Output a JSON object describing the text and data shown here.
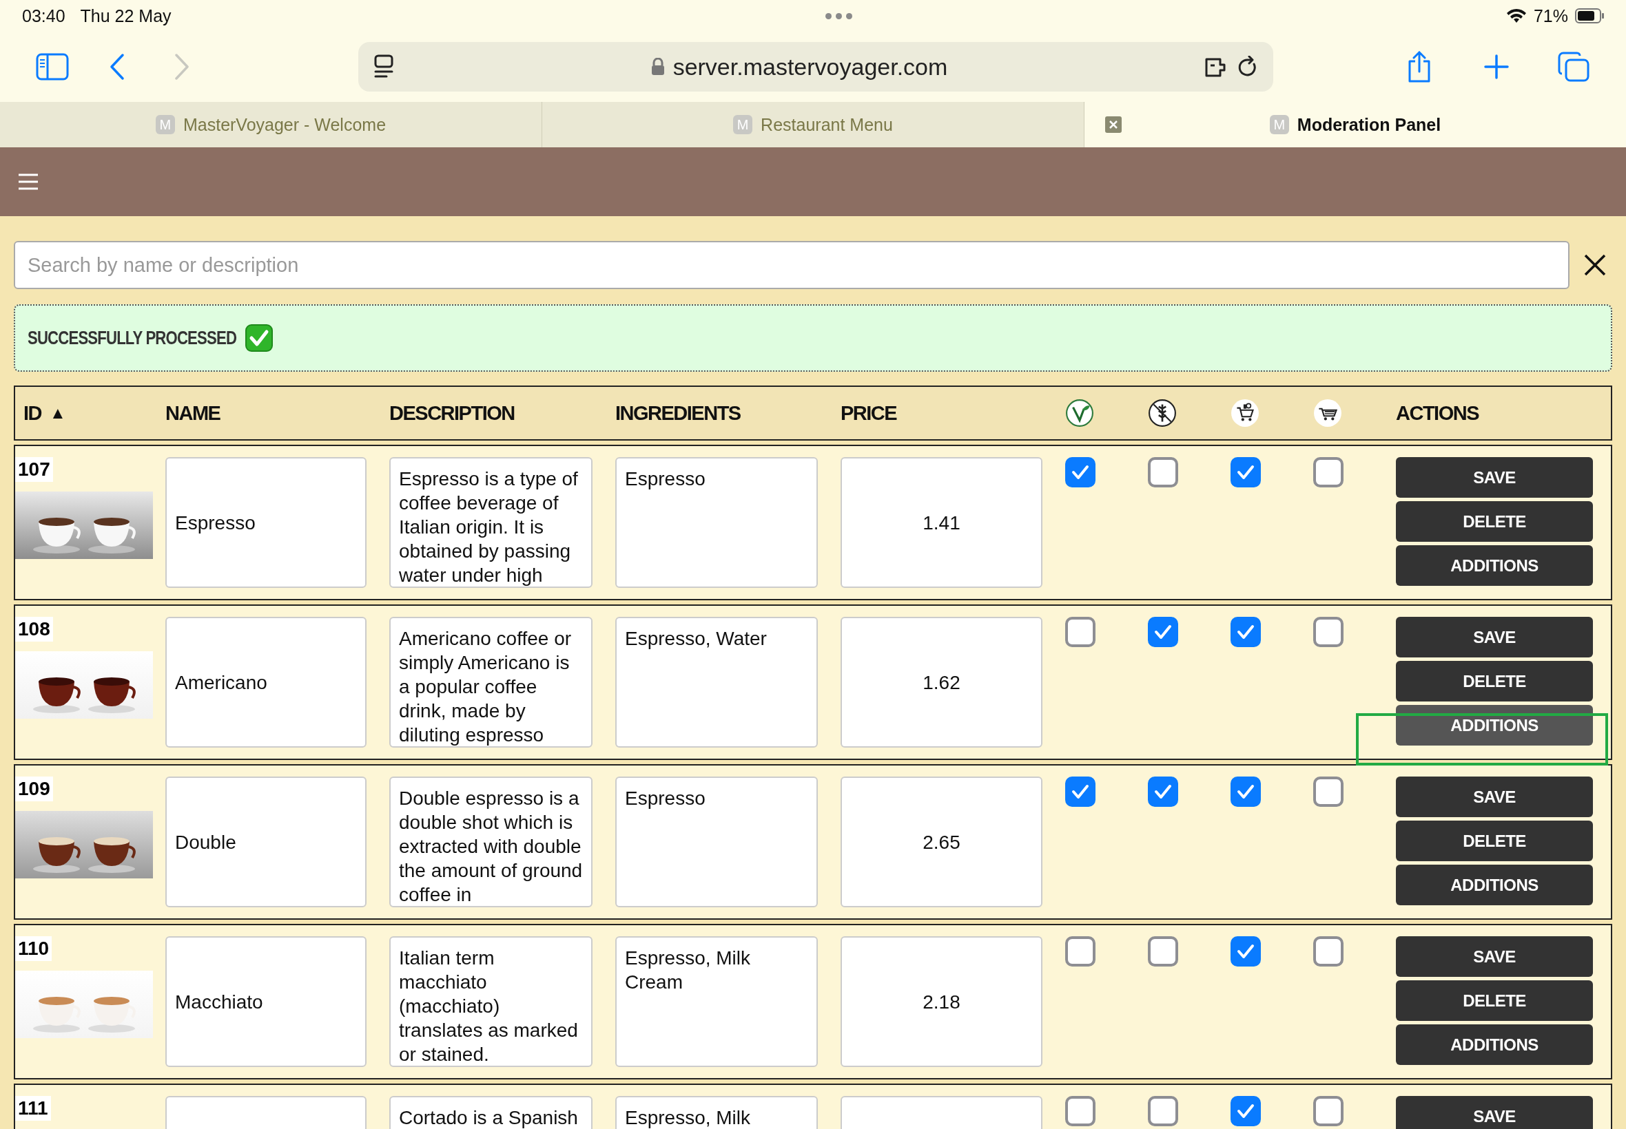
{
  "status_bar": {
    "time": "03:40",
    "date": "Thu 22 May",
    "battery": "71%"
  },
  "toolbar": {
    "url": "server.mastervoyager.com",
    "forward_disabled": true
  },
  "browser_tabs": [
    {
      "favicon": "M",
      "title": "MasterVoyager - Welcome",
      "selected": false
    },
    {
      "favicon": "M",
      "title": "Restaurant Menu",
      "selected": false
    },
    {
      "favicon": "M",
      "title": "Moderation Panel",
      "selected": true
    }
  ],
  "search": {
    "placeholder": "Search by name or description"
  },
  "notice": {
    "text": "SUCCESSFULLY PROCESSED"
  },
  "table": {
    "columns": [
      {
        "kind": "text",
        "label": "ID",
        "sort_mark": "▲"
      },
      {
        "kind": "text",
        "label": "NAME"
      },
      {
        "kind": "text",
        "label": "DESCRIPTION"
      },
      {
        "kind": "text",
        "label": "INGREDIENTS"
      },
      {
        "kind": "text",
        "label": "PRICE"
      },
      {
        "kind": "icon"
      },
      {
        "kind": "icon"
      },
      {
        "kind": "icon"
      },
      {
        "kind": "icon"
      },
      {
        "kind": "text",
        "label": "ACTIONS"
      }
    ],
    "rows": [
      {
        "id": "107",
        "photo": {
          "kind": "picture"
        },
        "name": "Espresso",
        "description": "Espresso is a type of coffee beverage of Italian origin. It is obtained by passing water under high",
        "ingredients": "Espresso",
        "price": "1.41",
        "flags": [
          {
            "checked": true
          },
          {
            "checked": false
          },
          {
            "checked": true
          },
          {
            "checked": false
          }
        ],
        "actions": [
          {
            "label": "SAVE",
            "focused": false
          },
          {
            "label": "DELETE",
            "focused": false
          },
          {
            "label": "ADDITIONS",
            "focused": false
          }
        ]
      },
      {
        "id": "108",
        "photo": {
          "kind": "picture"
        },
        "name": "Americano",
        "description": "Americano coffee or simply Americano is a popular coffee drink, made by diluting espresso",
        "ingredients": "Espresso, Water",
        "price": "1.62",
        "flags": [
          {
            "checked": false
          },
          {
            "checked": true
          },
          {
            "checked": true
          },
          {
            "checked": false
          }
        ],
        "actions": [
          {
            "label": "SAVE",
            "focused": false
          },
          {
            "label": "DELETE",
            "focused": false
          },
          {
            "label": "ADDITIONS",
            "focused": true
          }
        ]
      },
      {
        "id": "109",
        "photo": {
          "kind": "picture"
        },
        "name": "Double",
        "description": "Double espresso is a double shot which is extracted with double the amount of ground coffee in",
        "ingredients": "Espresso",
        "price": "2.65",
        "flags": [
          {
            "checked": true
          },
          {
            "checked": true
          },
          {
            "checked": true
          },
          {
            "checked": false
          }
        ],
        "actions": [
          {
            "label": "SAVE",
            "focused": false
          },
          {
            "label": "DELETE",
            "focused": false
          },
          {
            "label": "ADDITIONS",
            "focused": false
          }
        ]
      },
      {
        "id": "110",
        "photo": {
          "kind": "picture"
        },
        "name": "Macchiato",
        "description": "Italian term macchiato (macchiato) translates as marked or stained.",
        "ingredients": "Espresso, Milk Cream",
        "price": "2.18",
        "flags": [
          {
            "checked": false
          },
          {
            "checked": false
          },
          {
            "checked": true
          },
          {
            "checked": false
          }
        ],
        "actions": [
          {
            "label": "SAVE",
            "focused": false
          },
          {
            "label": "DELETE",
            "focused": false
          },
          {
            "label": "ADDITIONS",
            "focused": false
          }
        ]
      },
      {
        "id": "111",
        "description": "Cortado is a Spanish",
        "ingredients": "Espresso, Milk",
        "flags": [
          {
            "checked": false
          },
          {
            "checked": false
          },
          {
            "checked": true
          },
          {
            "checked": false
          }
        ],
        "actions": [
          {
            "label": "SAVE",
            "focused": false
          }
        ]
      }
    ]
  }
}
